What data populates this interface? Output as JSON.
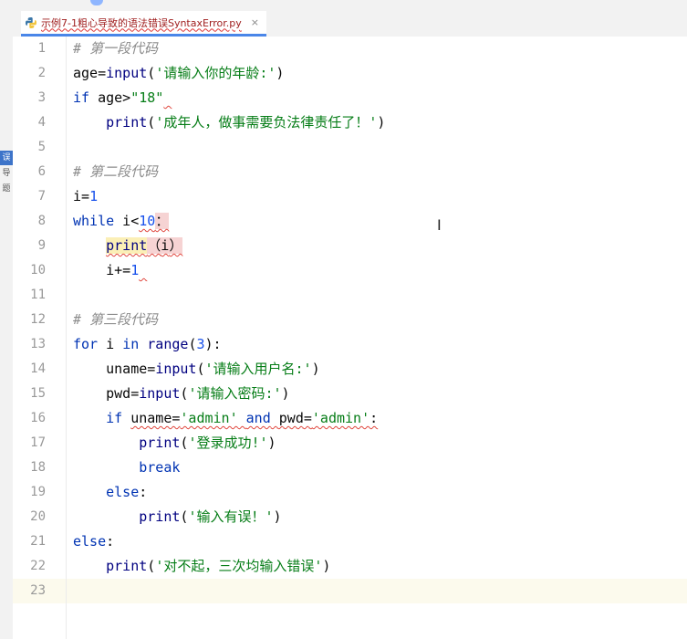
{
  "tab": {
    "filename": "示例7-1粗心导致的语法错误SyntaxError.py",
    "close": "×"
  },
  "side_tabs": [
    "误",
    "导",
    "题"
  ],
  "caret_glyph": "I",
  "lines": [
    {
      "n": "1",
      "indent": "",
      "tokens": [
        {
          "t": "# 第一段代码",
          "c": "cmt"
        }
      ]
    },
    {
      "n": "2",
      "indent": "",
      "tokens": [
        {
          "t": "age=",
          "c": ""
        },
        {
          "t": "input",
          "c": "bi"
        },
        {
          "t": "(",
          "c": ""
        },
        {
          "t": "'请输入你的年龄:'",
          "c": "str"
        },
        {
          "t": ")",
          "c": ""
        }
      ]
    },
    {
      "n": "3",
      "indent": "",
      "tokens": [
        {
          "t": "if",
          "c": "kw"
        },
        {
          "t": " age>",
          "c": ""
        },
        {
          "t": "\"18\"",
          "c": "str"
        },
        {
          "t": " ",
          "c": "err"
        }
      ]
    },
    {
      "n": "4",
      "indent": "    ",
      "tokens": [
        {
          "t": "print",
          "c": "bi"
        },
        {
          "t": "(",
          "c": ""
        },
        {
          "t": "'成年人，做事需要负法律责任了！'",
          "c": "str"
        },
        {
          "t": ")",
          "c": ""
        }
      ]
    },
    {
      "n": "5",
      "indent": "",
      "tokens": []
    },
    {
      "n": "6",
      "indent": "",
      "tokens": [
        {
          "t": "# 第二段代码",
          "c": "cmt"
        }
      ]
    },
    {
      "n": "7",
      "indent": "",
      "tokens": [
        {
          "t": "i=",
          "c": ""
        },
        {
          "t": "1",
          "c": "num"
        }
      ]
    },
    {
      "n": "8",
      "indent": "",
      "tokens": [
        {
          "t": "while",
          "c": "kw"
        },
        {
          "t": " i<",
          "c": ""
        },
        {
          "t": "10",
          "c": "num err"
        },
        {
          "t": "：",
          "c": "err errbox"
        }
      ]
    },
    {
      "n": "9",
      "indent": "    ",
      "tokens": [
        {
          "t": "print",
          "c": "bi err hl"
        },
        {
          "t": "（",
          "c": "err errbox"
        },
        {
          "t": "i",
          "c": "err errbox"
        },
        {
          "t": "）",
          "c": "err errbox"
        }
      ]
    },
    {
      "n": "10",
      "indent": "    ",
      "tokens": [
        {
          "t": "i+=",
          "c": ""
        },
        {
          "t": "1",
          "c": "num"
        },
        {
          "t": " ",
          "c": "err"
        }
      ]
    },
    {
      "n": "11",
      "indent": "",
      "tokens": []
    },
    {
      "n": "12",
      "indent": "",
      "tokens": [
        {
          "t": "# 第三段代码",
          "c": "cmt"
        }
      ]
    },
    {
      "n": "13",
      "indent": "",
      "tokens": [
        {
          "t": "for",
          "c": "kw"
        },
        {
          "t": " i ",
          "c": ""
        },
        {
          "t": "in",
          "c": "kw"
        },
        {
          "t": " ",
          "c": ""
        },
        {
          "t": "range",
          "c": "bi"
        },
        {
          "t": "(",
          "c": ""
        },
        {
          "t": "3",
          "c": "num"
        },
        {
          "t": "):",
          "c": ""
        }
      ]
    },
    {
      "n": "14",
      "indent": "    ",
      "tokens": [
        {
          "t": "uname=",
          "c": ""
        },
        {
          "t": "input",
          "c": "bi"
        },
        {
          "t": "(",
          "c": ""
        },
        {
          "t": "'请输入用户名:'",
          "c": "str"
        },
        {
          "t": ")",
          "c": ""
        }
      ]
    },
    {
      "n": "15",
      "indent": "    ",
      "tokens": [
        {
          "t": "pwd=",
          "c": ""
        },
        {
          "t": "input",
          "c": "bi"
        },
        {
          "t": "(",
          "c": ""
        },
        {
          "t": "'请输入密码:'",
          "c": "str"
        },
        {
          "t": ")",
          "c": ""
        }
      ]
    },
    {
      "n": "16",
      "indent": "    ",
      "tokens": [
        {
          "t": "if",
          "c": "kw"
        },
        {
          "t": " ",
          "c": ""
        },
        {
          "t": "uname=",
          "c": "err"
        },
        {
          "t": "'admin'",
          "c": "str err"
        },
        {
          "t": " ",
          "c": "err"
        },
        {
          "t": "and",
          "c": "kw err"
        },
        {
          "t": " pwd=",
          "c": "err"
        },
        {
          "t": "'admin'",
          "c": "str err"
        },
        {
          "t": ":",
          "c": "err"
        }
      ]
    },
    {
      "n": "17",
      "indent": "        ",
      "tokens": [
        {
          "t": "print",
          "c": "bi"
        },
        {
          "t": "(",
          "c": ""
        },
        {
          "t": "'登录成功!'",
          "c": "str"
        },
        {
          "t": ")",
          "c": ""
        }
      ]
    },
    {
      "n": "18",
      "indent": "        ",
      "tokens": [
        {
          "t": "break",
          "c": "kw"
        }
      ]
    },
    {
      "n": "19",
      "indent": "    ",
      "tokens": [
        {
          "t": "else",
          "c": "kw"
        },
        {
          "t": ":",
          "c": ""
        }
      ]
    },
    {
      "n": "20",
      "indent": "        ",
      "tokens": [
        {
          "t": "print",
          "c": "bi"
        },
        {
          "t": "(",
          "c": ""
        },
        {
          "t": "'输入有误！'",
          "c": "str"
        },
        {
          "t": ")",
          "c": ""
        }
      ]
    },
    {
      "n": "21",
      "indent": "",
      "tokens": [
        {
          "t": "else",
          "c": "kw"
        },
        {
          "t": ":",
          "c": ""
        }
      ]
    },
    {
      "n": "22",
      "indent": "    ",
      "tokens": [
        {
          "t": "print",
          "c": "bi"
        },
        {
          "t": "(",
          "c": ""
        },
        {
          "t": "'对不起，三次均输入错误'",
          "c": "str"
        },
        {
          "t": ")",
          "c": ""
        }
      ]
    },
    {
      "n": "23",
      "indent": "",
      "tokens": [],
      "current": true
    }
  ]
}
